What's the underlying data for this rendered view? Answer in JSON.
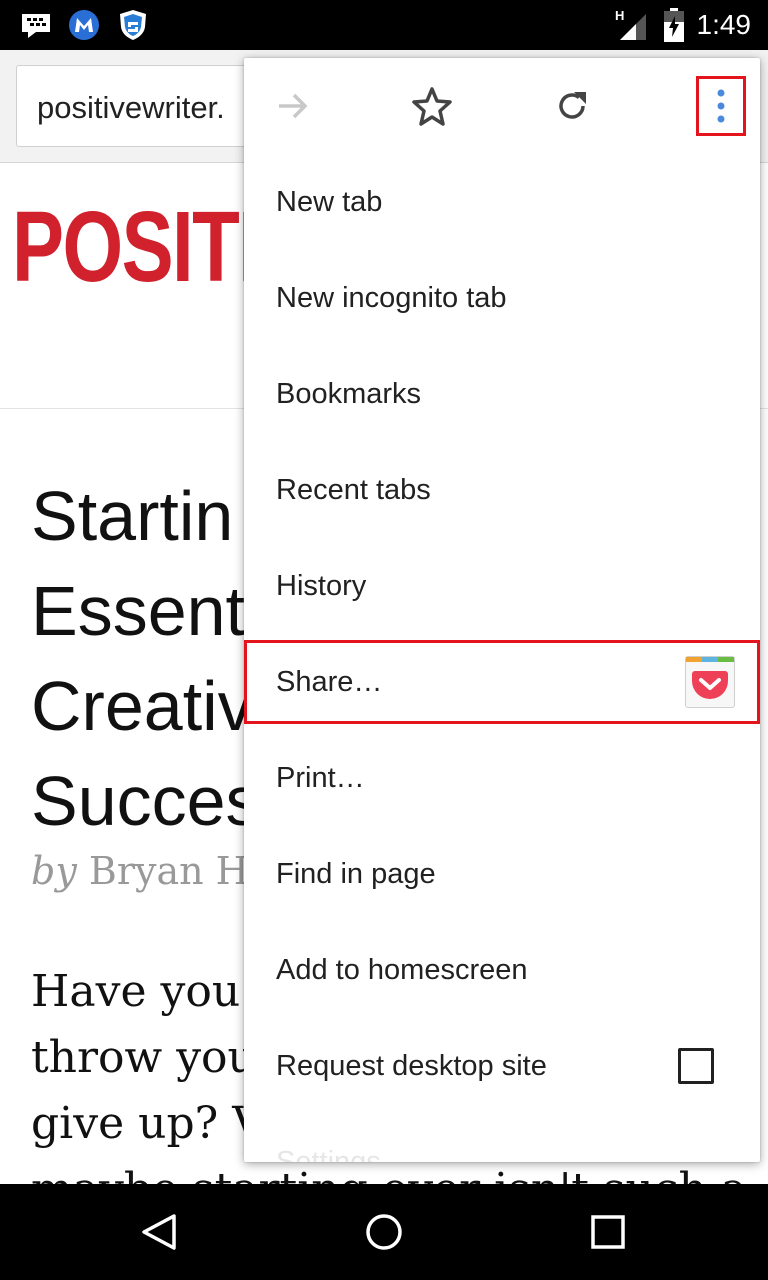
{
  "status_bar": {
    "time": "1:49",
    "network_type": "H",
    "icons": [
      "blackberry-messenger-icon",
      "malwarebytes-icon",
      "shield-icon",
      "signal-icon",
      "battery-icon"
    ]
  },
  "toolbar": {
    "url": "positivewriter."
  },
  "page": {
    "logo_text": "POSITI",
    "headline_lines": [
      "Startin",
      "Essent",
      "Creativ",
      "Succes"
    ],
    "byline_prefix": "by",
    "byline_author": "Bryan Hu",
    "body_lines": [
      "Have you",
      "throw you",
      "give up? V",
      "maybe starting over isn't such a"
    ]
  },
  "menu": {
    "icons": [
      "forward-icon",
      "star-icon",
      "reload-icon",
      "more-vert-icon"
    ],
    "items": [
      {
        "label": "New tab"
      },
      {
        "label": "New incognito tab"
      },
      {
        "label": "Bookmarks"
      },
      {
        "label": "Recent tabs"
      },
      {
        "label": "History"
      },
      {
        "label": "Share…",
        "highlighted": true,
        "icon": "pocket-icon"
      },
      {
        "label": "Print…"
      },
      {
        "label": "Find in page"
      },
      {
        "label": "Add to homescreen"
      },
      {
        "label": "Request desktop site",
        "checkbox": false
      },
      {
        "label": "Settings"
      }
    ],
    "highlight_color": "#e3141b",
    "accent_color": "#4a89dc"
  },
  "nav_bar": {
    "buttons": [
      "back-icon",
      "home-icon",
      "recents-icon"
    ]
  }
}
